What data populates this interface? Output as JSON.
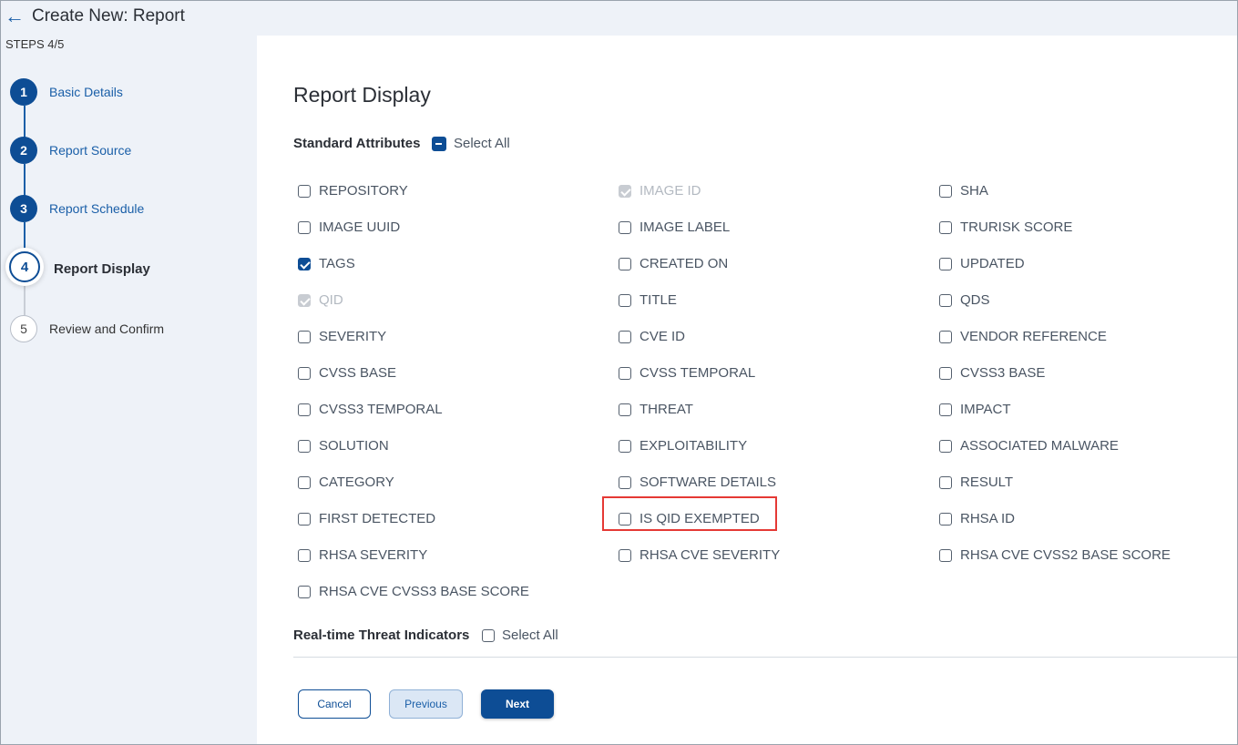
{
  "header": {
    "back_icon": "arrow-left-icon",
    "title": "Create New: Report"
  },
  "sidebar": {
    "steps_count": "STEPS 4/5",
    "steps": [
      {
        "number": "1",
        "label": "Basic Details",
        "state": "done"
      },
      {
        "number": "2",
        "label": "Report Source",
        "state": "done"
      },
      {
        "number": "3",
        "label": "Report Schedule",
        "state": "done"
      },
      {
        "number": "4",
        "label": "Report Display",
        "state": "active"
      },
      {
        "number": "5",
        "label": "Review and Confirm",
        "state": "pending"
      }
    ]
  },
  "main": {
    "title": "Report Display",
    "standard_attributes": {
      "heading": "Standard Attributes",
      "select_all_label": "Select All",
      "select_all_state": "indeterminate",
      "columns": [
        [
          {
            "label": "REPOSITORY",
            "state": "unchecked"
          },
          {
            "label": "IMAGE UUID",
            "state": "unchecked"
          },
          {
            "label": "TAGS",
            "state": "checked"
          },
          {
            "label": "QID",
            "state": "disabled"
          },
          {
            "label": "SEVERITY",
            "state": "unchecked"
          },
          {
            "label": "CVSS BASE",
            "state": "unchecked"
          },
          {
            "label": "CVSS3 TEMPORAL",
            "state": "unchecked"
          },
          {
            "label": "SOLUTION",
            "state": "unchecked"
          },
          {
            "label": "CATEGORY",
            "state": "unchecked"
          },
          {
            "label": "FIRST DETECTED",
            "state": "unchecked"
          },
          {
            "label": "RHSA SEVERITY",
            "state": "unchecked"
          },
          {
            "label": "RHSA CVE CVSS3 BASE SCORE",
            "state": "unchecked"
          }
        ],
        [
          {
            "label": "IMAGE ID",
            "state": "disabled"
          },
          {
            "label": "IMAGE LABEL",
            "state": "unchecked"
          },
          {
            "label": "CREATED ON",
            "state": "unchecked"
          },
          {
            "label": "TITLE",
            "state": "unchecked"
          },
          {
            "label": "CVE ID",
            "state": "unchecked"
          },
          {
            "label": "CVSS TEMPORAL",
            "state": "unchecked"
          },
          {
            "label": "THREAT",
            "state": "unchecked"
          },
          {
            "label": "EXPLOITABILITY",
            "state": "unchecked"
          },
          {
            "label": "SOFTWARE DETAILS",
            "state": "unchecked"
          },
          {
            "label": "IS QID EXEMPTED",
            "state": "unchecked"
          },
          {
            "label": "RHSA CVE SEVERITY",
            "state": "unchecked"
          }
        ],
        [
          {
            "label": "SHA",
            "state": "unchecked"
          },
          {
            "label": "TRURISK SCORE",
            "state": "unchecked"
          },
          {
            "label": "UPDATED",
            "state": "unchecked"
          },
          {
            "label": "QDS",
            "state": "unchecked"
          },
          {
            "label": "VENDOR REFERENCE",
            "state": "unchecked"
          },
          {
            "label": "CVSS3 BASE",
            "state": "unchecked"
          },
          {
            "label": "IMPACT",
            "state": "unchecked"
          },
          {
            "label": "ASSOCIATED MALWARE",
            "state": "unchecked"
          },
          {
            "label": "RESULT",
            "state": "unchecked"
          },
          {
            "label": "RHSA ID",
            "state": "unchecked"
          },
          {
            "label": "RHSA CVE CVSS2 BASE SCORE",
            "state": "unchecked"
          }
        ]
      ]
    },
    "threat_indicators": {
      "heading": "Real-time Threat Indicators",
      "select_all_label": "Select All",
      "select_all_state": "unchecked"
    },
    "buttons": {
      "cancel": "Cancel",
      "previous": "Previous",
      "next": "Next"
    }
  },
  "colors": {
    "primary": "#0d4d95",
    "link": "#1a5fa8",
    "sidebar_bg": "#eef2f8",
    "highlight": "#e53935"
  }
}
